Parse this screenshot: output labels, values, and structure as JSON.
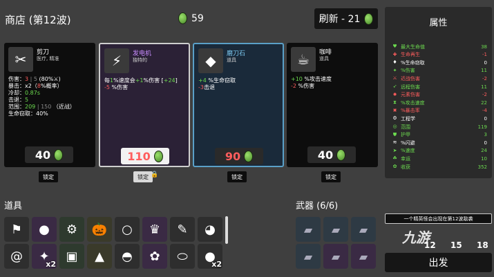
{
  "header": {
    "shop_title": "商店 (第12波)",
    "materials": "59",
    "reroll_label": "刷新 - 21"
  },
  "cards": [
    {
      "name": "剪刀",
      "tags": "医疗, 精准",
      "icon": "✂",
      "lines": [
        [
          {
            "t": "伤害：",
            "c": ""
          },
          {
            "t": "3",
            "c": "r"
          },
          {
            "t": " | 5 ",
            "c": "gr"
          },
          {
            "t": "(80%",
            "c": ""
          },
          {
            "t": "⚔",
            "c": ""
          },
          {
            "t": ")",
            "c": ""
          }
        ],
        [
          {
            "t": "暴击：x2（",
            "c": ""
          },
          {
            "t": "8",
            "c": "r"
          },
          {
            "t": "%概率）",
            "c": ""
          }
        ],
        [
          {
            "t": "冷却：",
            "c": ""
          },
          {
            "t": "0.87s",
            "c": "g"
          }
        ],
        [
          {
            "t": "击退：",
            "c": ""
          },
          {
            "t": "5",
            "c": "g"
          }
        ],
        [
          {
            "t": "范围：",
            "c": ""
          },
          {
            "t": "209",
            "c": "g"
          },
          {
            "t": " | 150 ",
            "c": "gr"
          },
          {
            "t": "（近战）",
            "c": ""
          }
        ],
        [
          {
            "t": "生命窃取：40%",
            "c": ""
          }
        ]
      ],
      "price": "40",
      "price_color": "#ffffff",
      "lock_label": "锁定",
      "locked": false
    },
    {
      "name": "发电机",
      "tags": "独特的",
      "icon": "⚡",
      "lines": [
        [
          {
            "t": "每",
            "c": ""
          },
          {
            "t": "1",
            "c": "g"
          },
          {
            "t": "%速度会",
            "c": ""
          },
          {
            "t": "+1",
            "c": "g"
          },
          {
            "t": "%伤害 [",
            "c": ""
          },
          {
            "t": "+24",
            "c": "g"
          },
          {
            "t": "]",
            "c": ""
          }
        ],
        [
          {
            "t": "-5",
            "c": "r"
          },
          {
            "t": " %伤害",
            "c": ""
          }
        ]
      ],
      "price": "110",
      "price_color": "#ff5d5d",
      "lock_label": "锁定",
      "locked": true
    },
    {
      "name": "磨刀石",
      "tags": "道具",
      "icon": "◆",
      "lines": [
        [
          {
            "t": "+4",
            "c": "g"
          },
          {
            "t": " %生命窃取",
            "c": ""
          }
        ],
        [
          {
            "t": "-3",
            "c": "r"
          },
          {
            "t": "击退",
            "c": ""
          }
        ]
      ],
      "price": "90",
      "price_color": "#ff5d5d",
      "lock_label": "锁定",
      "locked": false
    },
    {
      "name": "咖啡",
      "tags": "道具",
      "icon": "☕",
      "lines": [
        [
          {
            "t": "+10",
            "c": "g"
          },
          {
            "t": " %攻击速度",
            "c": ""
          }
        ],
        [
          {
            "t": "-2",
            "c": "r"
          },
          {
            "t": " %伤害",
            "c": ""
          }
        ]
      ],
      "price": "40",
      "price_color": "#ffffff",
      "lock_label": "锁定",
      "locked": false
    }
  ],
  "stats": {
    "title": "属性",
    "rows": [
      {
        "label": "最大生命值",
        "value": "38",
        "color": "#6cdb4f",
        "icon": "♥"
      },
      {
        "label": "生命再生",
        "value": "-1",
        "color": "#ff5d5d",
        "icon": "✚"
      },
      {
        "label": "%生命窃取",
        "value": "0",
        "color": "#ffffff",
        "icon": "♦"
      },
      {
        "label": "%伤害",
        "value": "11",
        "color": "#6cdb4f",
        "icon": "✦"
      },
      {
        "label": "近战伤害",
        "value": "-2",
        "color": "#ff5d5d",
        "icon": "⚔"
      },
      {
        "label": "远程伤害",
        "value": "11",
        "color": "#6cdb4f",
        "icon": "➶"
      },
      {
        "label": "元素伤害",
        "value": "-2",
        "color": "#ff5d5d",
        "icon": "✹"
      },
      {
        "label": "%攻击速度",
        "value": "22",
        "color": "#6cdb4f",
        "icon": "⧗"
      },
      {
        "label": "%暴击率",
        "value": "-4",
        "color": "#ff5d5d",
        "icon": "✖"
      },
      {
        "label": "工程学",
        "value": "0",
        "color": "#ffffff",
        "icon": "⚙"
      },
      {
        "label": "范围",
        "value": "119",
        "color": "#6cdb4f",
        "icon": "◎"
      },
      {
        "label": "护甲",
        "value": "3",
        "color": "#6cdb4f",
        "icon": "⛊"
      },
      {
        "label": "%闪避",
        "value": "0",
        "color": "#ffffff",
        "icon": "≋"
      },
      {
        "label": "%速度",
        "value": "24",
        "color": "#6cdb4f",
        "icon": "➤"
      },
      {
        "label": "幸运",
        "value": "10",
        "color": "#6cdb4f",
        "icon": "☘"
      },
      {
        "label": "收获",
        "value": "352",
        "color": "#6cdb4f",
        "icon": "✿"
      }
    ]
  },
  "inventory": {
    "items_title": "道具",
    "weapons_title": "武器 (6/6)",
    "items_row1": [
      {
        "icon": "⚑",
        "name": "item-flag-icon"
      },
      {
        "icon": "●",
        "name": "item-red-orb-icon"
      },
      {
        "icon": "⚙",
        "name": "item-tractor-icon"
      },
      {
        "icon": "🎃",
        "name": "item-pumpkin-icon"
      },
      {
        "icon": "○",
        "name": "item-ring-icon"
      },
      {
        "icon": "♛",
        "name": "item-crown-icon"
      },
      {
        "icon": "✎",
        "name": "item-pen-icon"
      },
      {
        "icon": "◕",
        "name": "item-duck-icon"
      }
    ],
    "items_row2": [
      {
        "icon": "@",
        "name": "item-snail-icon",
        "count": ""
      },
      {
        "icon": "✦",
        "name": "item-wings-icon",
        "count": "x2"
      },
      {
        "icon": "▣",
        "name": "item-ticket-icon",
        "count": ""
      },
      {
        "icon": "▲",
        "name": "item-bag-icon",
        "count": ""
      },
      {
        "icon": "◓",
        "name": "item-helmet-icon",
        "count": ""
      },
      {
        "icon": "✿",
        "name": "item-rabbit-icon",
        "count": ""
      },
      {
        "icon": "⬭",
        "name": "item-capsule-icon",
        "count": ""
      },
      {
        "icon": "●",
        "name": "item-ball-icon",
        "count": "x2"
      }
    ],
    "weapons_row1": [
      {
        "icon": "▰",
        "name": "weapon-gun-icon",
        "count": ""
      },
      {
        "icon": "▰",
        "name": "weapon-gun-icon",
        "count": ""
      },
      {
        "icon": "▰",
        "name": "weapon-gun-icon",
        "count": ""
      }
    ],
    "weapons_row2": [
      {
        "icon": "▰",
        "name": "weapon-gun-icon",
        "count": ""
      },
      {
        "icon": "▰",
        "name": "weapon-shotgun-icon",
        "count": ""
      },
      {
        "icon": "▰",
        "name": "weapon-shotgun-icon",
        "count": ""
      }
    ],
    "right_counts": [
      "12",
      "15",
      "18"
    ],
    "notice": "一个精英怪会出现在第12波敌袭",
    "go_label": "出发",
    "watermark": "九游"
  }
}
